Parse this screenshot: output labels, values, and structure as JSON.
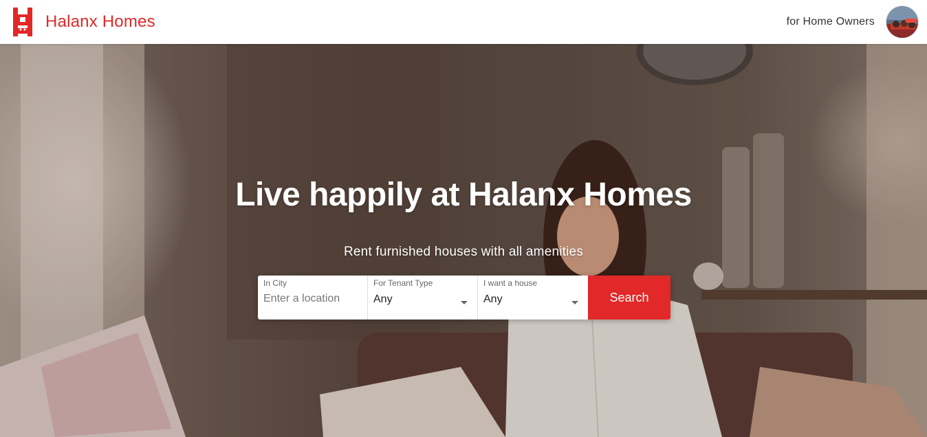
{
  "header": {
    "brand_name": "Halanx Homes",
    "owners_link": "for Home Owners",
    "logo_icon": "halanx-logo-icon",
    "avatar_icon": "user-avatar"
  },
  "hero": {
    "title": "Live happily at Halanx Homes",
    "subtitle": "Rent furnished houses with all amenities"
  },
  "search": {
    "city": {
      "label": "In City",
      "placeholder": "Enter a location"
    },
    "tenant_type": {
      "label": "For Tenant Type",
      "value": "Any"
    },
    "house_type": {
      "label": "I want a house",
      "value": "Any"
    },
    "button_label": "Search"
  },
  "colors": {
    "brand": "#e22828",
    "header_bg": "#ffffff",
    "hero_text": "#ffffff"
  }
}
